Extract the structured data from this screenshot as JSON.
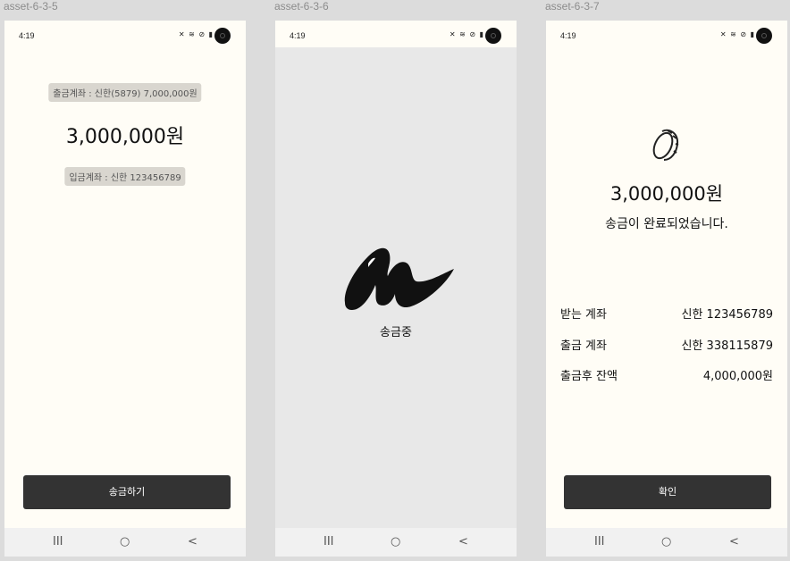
{
  "frames": [
    {
      "label": "asset-6-3-5"
    },
    {
      "label": "asset-6-3-6"
    },
    {
      "label": "asset-6-3-7"
    }
  ],
  "status": {
    "time": "4:19",
    "icons": "🔇 wifi ⊘ battery"
  },
  "screen1": {
    "withdraw_account": "출금계좌 : 신한(5879) 7,000,000원",
    "amount": "3,000,000원",
    "deposit_account": "입금계좌 : 신한 123456789",
    "send_button": "송금하기"
  },
  "screen2": {
    "loading_text": "송금중"
  },
  "screen3": {
    "amount": "3,000,000원",
    "complete_message": "송금이 완료되었습니다.",
    "rows": [
      {
        "label": "받는 계좌",
        "value": "신한 123456789"
      },
      {
        "label": "출금 계좌",
        "value": "신한 338115879"
      },
      {
        "label": "출금후 잔액",
        "value": "4,000,000원"
      }
    ],
    "confirm_button": "확인"
  },
  "navbar": {
    "recent": "III",
    "home": "○",
    "back": "<"
  }
}
